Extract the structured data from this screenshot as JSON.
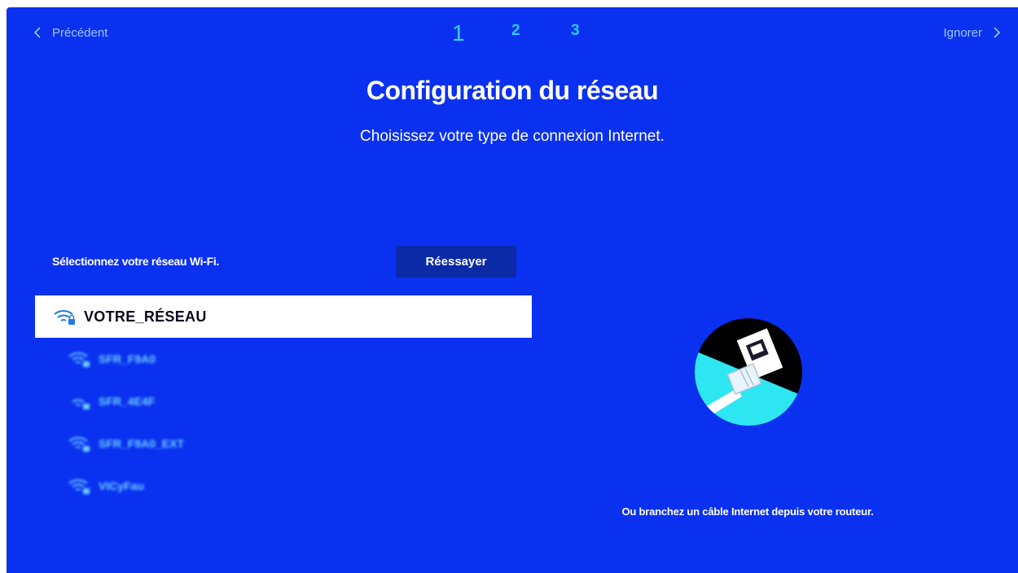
{
  "nav": {
    "back_label": "Précédent",
    "skip_label": "Ignorer"
  },
  "steps": [
    "1",
    "2",
    "3"
  ],
  "header": {
    "title": "Configuration du réseau",
    "subtitle": "Choisissez votre type de connexion Internet."
  },
  "wifi": {
    "prompt": "Sélectionnez votre réseau Wi-Fi.",
    "retry_label": "Réessayer",
    "networks": [
      {
        "name": "VOTRE_RÉSEAU",
        "secured": true,
        "selected": true
      },
      {
        "name": "SFR_F9A0",
        "secured": true,
        "selected": false
      },
      {
        "name": "SFR_4E4F",
        "secured": true,
        "selected": false
      },
      {
        "name": "SFR_F9A0_EXT",
        "secured": true,
        "selected": false
      },
      {
        "name": "VICyFau",
        "secured": true,
        "selected": false
      }
    ]
  },
  "cable": {
    "text": "Ou branchez un câble Internet depuis votre routeur."
  },
  "colors": {
    "background": "#0a31f0",
    "step_active": "#38d0ff",
    "nav_text": "#9fc8ff",
    "network_text": "#6fd0ff",
    "button": "#0a2aa8",
    "illustration_cyan": "#2ee6f2"
  },
  "icons": [
    "chevron-left-icon",
    "chevron-right-icon",
    "wifi-lock-icon",
    "ethernet-port-icon"
  ]
}
